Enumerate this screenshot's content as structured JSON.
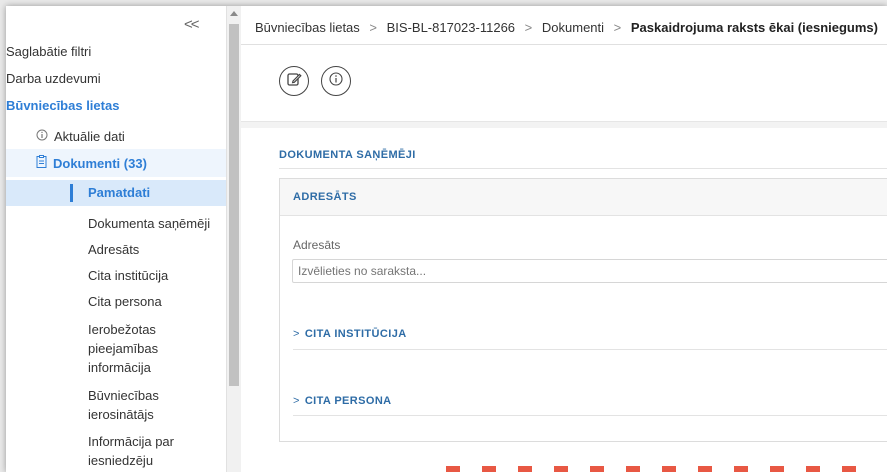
{
  "sidebar": {
    "collapse_label": "<<",
    "top_items": [
      {
        "label": "Saglabātie filtri"
      },
      {
        "label": "Darba uzdevumi"
      },
      {
        "label": "Būvniecības lietas"
      }
    ],
    "sub_items": [
      {
        "label": "Aktuālie dati",
        "icon": "info-circle-icon"
      },
      {
        "label": "Dokumenti (33)",
        "icon": "document-icon"
      }
    ],
    "leaf_items": [
      {
        "label": "Pamatdati"
      },
      {
        "label": "Dokumenta saņēmēji"
      },
      {
        "label": "Adresāts"
      },
      {
        "label": "Cita institūcija"
      },
      {
        "label": "Cita persona"
      },
      {
        "label": "Ierobežotas pieejamības informācija"
      },
      {
        "label": "Būvniecības ierosinātājs"
      },
      {
        "label": "Informācija par iesniedzēju"
      }
    ]
  },
  "breadcrumb": {
    "items": [
      "Būvniecības lietas",
      "BIS-BL-817023-11266",
      "Dokumenti"
    ],
    "current": "Paskaidrojuma raksts ēkai (iesniegums)",
    "separator": ">"
  },
  "toolbar": {
    "buttons": [
      {
        "icon": "edit-icon"
      },
      {
        "icon": "info-circle-icon"
      }
    ]
  },
  "content": {
    "section_title": "DOKUMENTA SAŅĒMĒJI",
    "card_title": "ADRESĀTS",
    "field_label": "Adresāts",
    "field_placeholder": "Izvēlieties no saraksta...",
    "collapsibles": [
      {
        "label": "CITA INSTITŪCIJA",
        "chevron": ">"
      },
      {
        "label": "CITA PERSONA",
        "chevron": ">"
      }
    ]
  },
  "colors": {
    "accent": "#2e7ed6",
    "section_title": "#2e6ca6",
    "active_bg": "#d9e9fa"
  }
}
